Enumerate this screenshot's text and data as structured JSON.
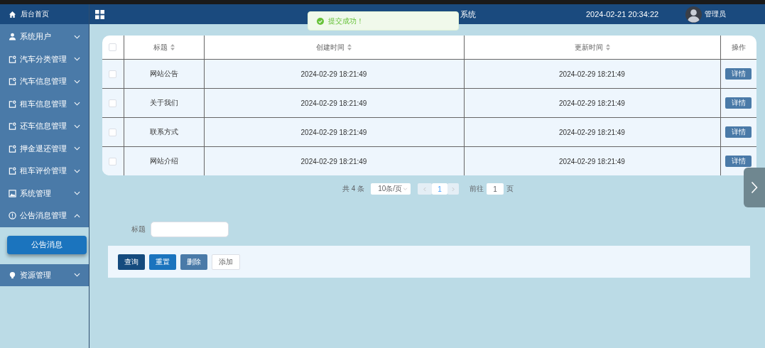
{
  "sidebar": {
    "home": "后台首页",
    "items": [
      {
        "label": "系统用户",
        "expanded": false
      },
      {
        "label": "汽车分类管理",
        "expanded": false
      },
      {
        "label": "汽车信息管理",
        "expanded": false
      },
      {
        "label": "租车信息管理",
        "expanded": false
      },
      {
        "label": "还车信息管理",
        "expanded": false
      },
      {
        "label": "押金退还管理",
        "expanded": false
      },
      {
        "label": "租车评价管理",
        "expanded": false
      },
      {
        "label": "系统管理",
        "expanded": false
      },
      {
        "label": "公告消息管理",
        "expanded": true,
        "children": [
          {
            "label": "公告消息",
            "selected": true
          }
        ]
      },
      {
        "label": "资源管理",
        "expanded": false
      }
    ]
  },
  "header": {
    "title": "系统",
    "datetime": "2024-02-21 20:34:22",
    "user": "管理员"
  },
  "toast": {
    "kind": "success",
    "message": "提交成功！"
  },
  "table": {
    "all_checked": false,
    "columns": [
      {
        "label": "标题",
        "sortable": true
      },
      {
        "label": "创建时间",
        "sortable": true
      },
      {
        "label": "更新时间",
        "sortable": true
      },
      {
        "label": "操作",
        "sortable": false
      }
    ],
    "rows": [
      {
        "checked": false,
        "title": "网站公告",
        "created": "2024-02-29 18:21:49",
        "updated": "2024-02-29 18:21:49",
        "action": "详情"
      },
      {
        "checked": false,
        "title": "关于我们",
        "created": "2024-02-29 18:21:49",
        "updated": "2024-02-29 18:21:49",
        "action": "详情"
      },
      {
        "checked": false,
        "title": "联系方式",
        "created": "2024-02-29 18:21:49",
        "updated": "2024-02-29 18:21:49",
        "action": "详情"
      },
      {
        "checked": false,
        "title": "网站介绍",
        "created": "2024-02-29 18:21:49",
        "updated": "2024-02-29 18:21:49",
        "action": "详情"
      }
    ]
  },
  "pagination": {
    "total": "共 4 条",
    "page_size": "10条/页",
    "current": "1",
    "goto_label": "前往",
    "goto_value": "1",
    "page_suffix": "页"
  },
  "search": {
    "label": "标题",
    "buttons": [
      {
        "label": "查询",
        "kind": "dark"
      },
      {
        "label": "重置",
        "kind": "blue"
      },
      {
        "label": "删除",
        "kind": "muted"
      },
      {
        "label": "添加",
        "kind": "plain"
      }
    ]
  }
}
